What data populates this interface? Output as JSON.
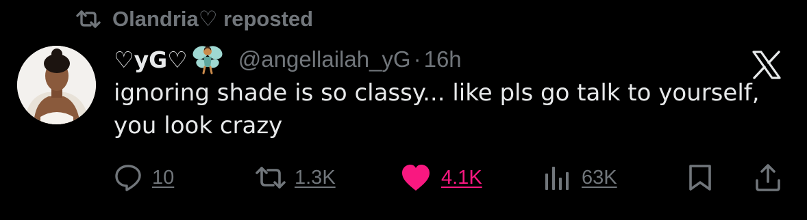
{
  "repost": {
    "text": "Olandria♡ reposted",
    "icon": "repost-icon"
  },
  "tweet": {
    "display_name": "♡yG♡",
    "name_emoji": "fairy-emoji",
    "handle": "@angellailah_yG",
    "separator": "·",
    "time": "16h",
    "text": "ignoring shade is so classy... like pls go talk to yourself, you look crazy",
    "platform_logo": "x-logo"
  },
  "actions": {
    "reply": {
      "icon": "reply-icon",
      "count": "10"
    },
    "retweet": {
      "icon": "retweet-icon",
      "count": "1.3K"
    },
    "like": {
      "icon": "heart-icon",
      "count": "4.1K",
      "color": "#f91880",
      "liked": true
    },
    "views": {
      "icon": "views-icon",
      "count": "63K"
    },
    "bookmark": {
      "icon": "bookmark-icon"
    },
    "share": {
      "icon": "share-icon"
    }
  },
  "colors": {
    "background": "#000000",
    "primary_text": "#e7e9ea",
    "secondary_text": "#71767b",
    "like_accent": "#f91880"
  }
}
